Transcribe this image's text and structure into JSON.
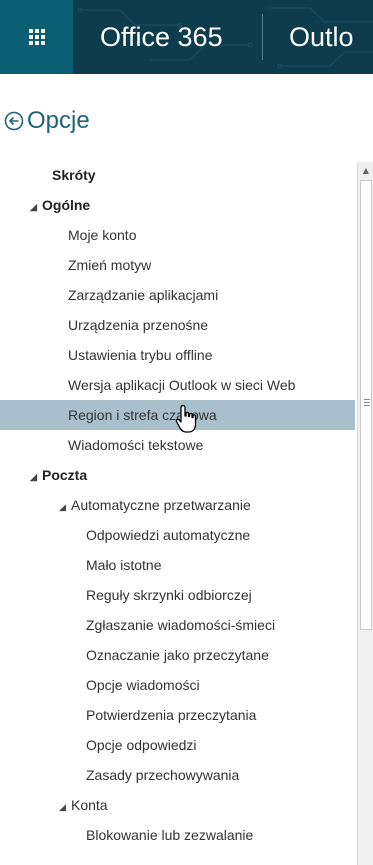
{
  "topbar": {
    "brand": "Office 365",
    "app": "Outlo",
    "launcher_icon": "app-launcher-waffle-icon",
    "color": "#0d3d4d",
    "launcher_color": "#0a5e71"
  },
  "header": {
    "back_icon": "back-arrow-circle-icon",
    "title": "Opcje"
  },
  "nav": {
    "items": [
      {
        "label": "Skróty",
        "level": 0,
        "caret": "",
        "selected": false
      },
      {
        "label": "Ogólne",
        "level": 0,
        "caret": "◢",
        "selected": false
      },
      {
        "label": "Moje konto",
        "level": 1,
        "caret": "",
        "selected": false
      },
      {
        "label": "Zmień motyw",
        "level": 1,
        "caret": "",
        "selected": false
      },
      {
        "label": "Zarządzanie aplikacjami",
        "level": 1,
        "caret": "",
        "selected": false
      },
      {
        "label": "Urządzenia przenośne",
        "level": 1,
        "caret": "",
        "selected": false
      },
      {
        "label": "Ustawienia trybu offline",
        "level": 1,
        "caret": "",
        "selected": false
      },
      {
        "label": "Wersja aplikacji Outlook w sieci Web",
        "level": 1,
        "caret": "",
        "selected": false
      },
      {
        "label": "Region i strefa czasowa",
        "level": 1,
        "caret": "",
        "selected": true
      },
      {
        "label": "Wiadomości tekstowe",
        "level": 1,
        "caret": "",
        "selected": false
      },
      {
        "label": "Poczta",
        "level": 0,
        "caret": "◢",
        "selected": false
      },
      {
        "label": "Automatyczne przetwarzanie",
        "level": 1,
        "caret": "◢",
        "selected": false
      },
      {
        "label": "Odpowiedzi automatyczne",
        "level": 2,
        "caret": "",
        "selected": false
      },
      {
        "label": "Mało istotne",
        "level": 2,
        "caret": "",
        "selected": false
      },
      {
        "label": "Reguły skrzynki odbiorczej",
        "level": 2,
        "caret": "",
        "selected": false
      },
      {
        "label": "Zgłaszanie wiadomości-śmieci",
        "level": 2,
        "caret": "",
        "selected": false
      },
      {
        "label": "Oznaczanie jako przeczytane",
        "level": 2,
        "caret": "",
        "selected": false
      },
      {
        "label": "Opcje wiadomości",
        "level": 2,
        "caret": "",
        "selected": false
      },
      {
        "label": "Potwierdzenia przeczytania",
        "level": 2,
        "caret": "",
        "selected": false
      },
      {
        "label": "Opcje odpowiedzi",
        "level": 2,
        "caret": "",
        "selected": false
      },
      {
        "label": "Zasady przechowywania",
        "level": 2,
        "caret": "",
        "selected": false
      },
      {
        "label": "Konta",
        "level": 1,
        "caret": "◢",
        "selected": false
      },
      {
        "label": "Blokowanie lub zezwalanie",
        "level": 2,
        "caret": "",
        "selected": false
      }
    ]
  },
  "scrollbar": {
    "up_icon": "scroll-up-arrow-icon"
  },
  "cursor": {
    "icon": "hand-pointer-icon"
  }
}
